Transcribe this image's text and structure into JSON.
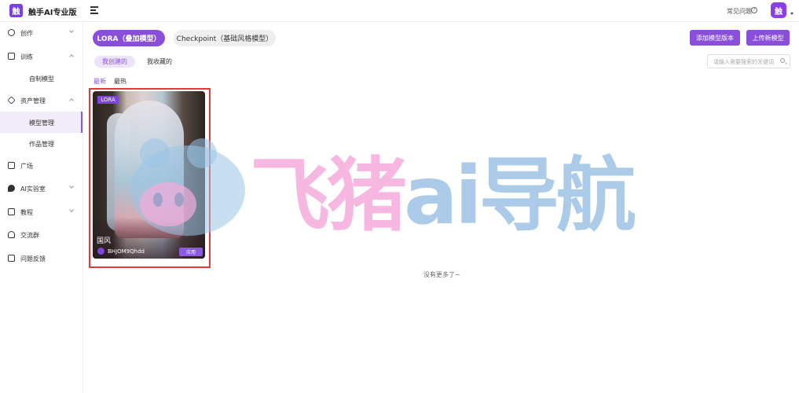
{
  "app": {
    "logo_char": "触",
    "title": "触手AI专业版"
  },
  "header": {
    "faq": "常见问题",
    "faq_icon": "?",
    "avatar_char": "触"
  },
  "sidebar": {
    "items": [
      {
        "label": "创作"
      },
      {
        "label": "训练"
      },
      {
        "label": "自制模型"
      },
      {
        "label": "资产管理"
      },
      {
        "label": "模型管理"
      },
      {
        "label": "作品管理"
      },
      {
        "label": "广场"
      },
      {
        "label": "AI实验室"
      },
      {
        "label": "教程"
      },
      {
        "label": "交流群"
      },
      {
        "label": "问题反馈"
      }
    ]
  },
  "main": {
    "type_tabs": [
      {
        "label": "LORA（叠加模型）"
      },
      {
        "label": "Checkpoint（基础风格模型）"
      }
    ],
    "buttons": {
      "add_version": "添加模型版本",
      "upload": "上传新模型"
    },
    "sub_tabs": [
      {
        "label": "我创建的"
      },
      {
        "label": "我收藏的"
      }
    ],
    "search": {
      "placeholder": "请输入需要搜索的关键词"
    },
    "sort": [
      {
        "label": "最新"
      },
      {
        "label": "最热"
      }
    ],
    "cards": [
      {
        "badge": "LORA",
        "name": "国风",
        "user": "BHJOM9Qhdd",
        "use_label": "应用"
      }
    ],
    "empty_text": "没有更多了~"
  },
  "watermark": {
    "part1": "飞猪",
    "part2": "ai导航"
  },
  "colors": {
    "accent": "#8a4fd8",
    "highlight_border": "#e23a3a"
  }
}
